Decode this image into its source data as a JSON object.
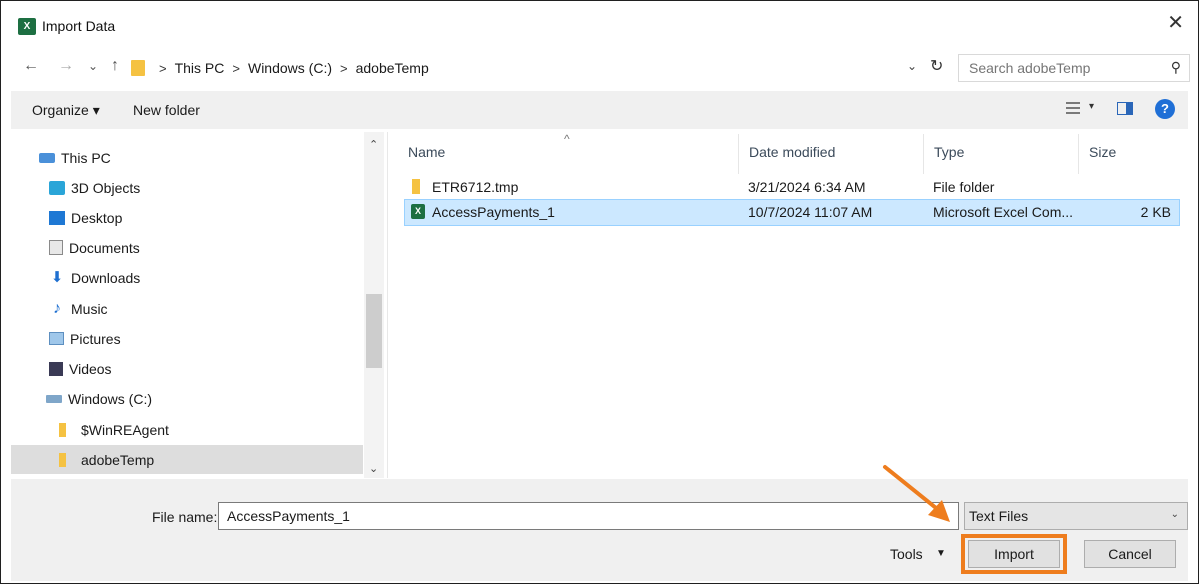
{
  "window": {
    "title": "Import Data",
    "app_icon": "excel-icon",
    "close_glyph": "✕"
  },
  "nav": {
    "back_glyph": "←",
    "forward_glyph": "→",
    "recent_glyph": "⌄",
    "up_glyph": "↑",
    "breadcrumb": [
      "This PC",
      "Windows (C:)",
      "adobeTemp"
    ],
    "breadcrumb_sep": ">",
    "dropdown_glyph": "⌄",
    "refresh_glyph": "↻",
    "search_placeholder": "Search adobeTemp",
    "search_glyph": "⚲"
  },
  "toolbar": {
    "organize_label": "Organize ▾",
    "new_folder_label": "New folder",
    "help_glyph": "?"
  },
  "sidebar": {
    "items": [
      {
        "label": "This PC",
        "icon": "this-pc-icon"
      },
      {
        "label": "3D Objects",
        "icon": "3d-objects-icon"
      },
      {
        "label": "Desktop",
        "icon": "desktop-icon"
      },
      {
        "label": "Documents",
        "icon": "documents-icon"
      },
      {
        "label": "Downloads",
        "icon": "downloads-icon"
      },
      {
        "label": "Music",
        "icon": "music-icon"
      },
      {
        "label": "Pictures",
        "icon": "pictures-icon"
      },
      {
        "label": "Videos",
        "icon": "videos-icon"
      },
      {
        "label": "Windows (C:)",
        "icon": "drive-icon"
      },
      {
        "label": "$WinREAgent",
        "icon": "folder-icon"
      },
      {
        "label": "adobeTemp",
        "icon": "folder-icon",
        "selected": true
      }
    ]
  },
  "file_list": {
    "columns": [
      "Name",
      "Date modified",
      "Type",
      "Size"
    ],
    "rows": [
      {
        "name": "ETR6712.tmp",
        "date": "3/21/2024 6:34 AM",
        "type": "File folder",
        "size": "",
        "icon": "folder-icon",
        "selected": false
      },
      {
        "name": "AccessPayments_1",
        "date": "10/7/2024 11:07 AM",
        "type": "Microsoft Excel Com...",
        "size": "2 KB",
        "icon": "excel-file-icon",
        "selected": true
      }
    ]
  },
  "footer": {
    "file_name_label": "File name:",
    "file_name_value": "AccessPayments_1",
    "file_type_value": "Text Files",
    "tools_label": "Tools",
    "import_label": "Import",
    "cancel_label": "Cancel"
  },
  "colors": {
    "highlight_orange": "#ee7d1e",
    "selection_blue": "#cce8ff"
  }
}
